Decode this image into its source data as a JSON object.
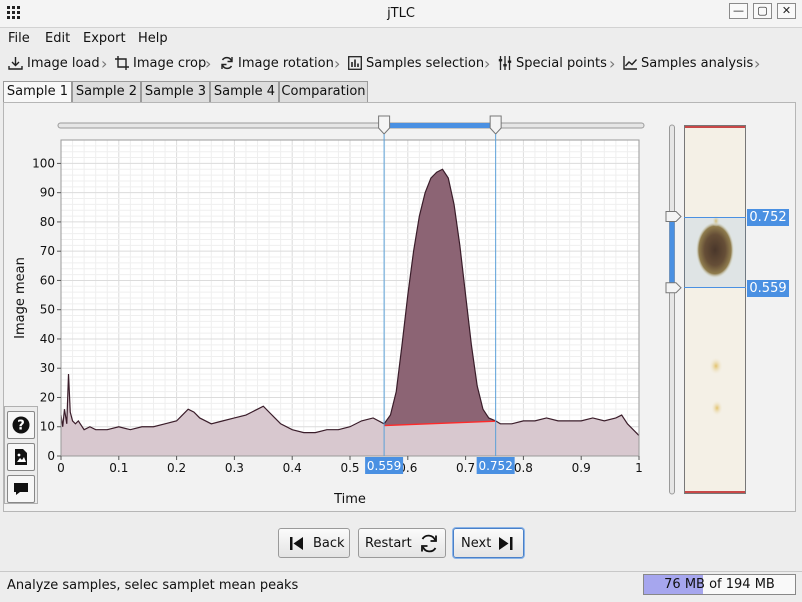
{
  "window": {
    "title": "jTLC",
    "min_symbol": "—",
    "max_symbol": "▢",
    "close_symbol": "✕"
  },
  "menu": {
    "items": [
      "File",
      "Edit",
      "Export",
      "Help"
    ]
  },
  "breadcrumb": {
    "items": [
      {
        "label": "Image load",
        "icon": "download-icon"
      },
      {
        "label": "Image crop",
        "icon": "crop-icon"
      },
      {
        "label": "Image rotation",
        "icon": "rotate-icon"
      },
      {
        "label": "Samples selection",
        "icon": "bar-chart-icon"
      },
      {
        "label": "Special points",
        "icon": "sliders-icon"
      },
      {
        "label": "Samples analysis",
        "icon": "line-chart-icon"
      }
    ]
  },
  "tabs": {
    "items": [
      "Sample 1",
      "Sample 2",
      "Sample 3",
      "Sample 4",
      "Comparation"
    ],
    "selected": 0
  },
  "range_slider": {
    "low": 0.559,
    "high": 0.752,
    "low_label": "0.559",
    "high_label": "0.752"
  },
  "strip": {
    "high_label": "0.752",
    "low_label": "0.559"
  },
  "chart_data": {
    "type": "area",
    "xlabel": "Time",
    "ylabel": "Image mean",
    "xlim": [
      0,
      1
    ],
    "ylim": [
      0,
      108
    ],
    "x_ticks": [
      0,
      0.1,
      0.2,
      0.3,
      0.4,
      0.5,
      0.6,
      0.7,
      0.8,
      0.9,
      1
    ],
    "x_tick_labels": [
      "0",
      "0.1",
      "0.2",
      "0.3",
      "0.4",
      "0.5",
      "0.6",
      "0.7",
      "0.8",
      "0.9",
      "1"
    ],
    "y_ticks": [
      0,
      10,
      20,
      30,
      40,
      50,
      60,
      70,
      80,
      90,
      100
    ],
    "y_tick_labels": [
      "0",
      "10",
      "20",
      "30",
      "40",
      "50",
      "60",
      "70",
      "80",
      "90",
      "100"
    ],
    "grid": true,
    "colors": {
      "area": "#d8c8cf",
      "peak_area": "#8c6474",
      "line": "#3a1d2a",
      "baseline": "#ff2a2a",
      "selection": "#5aa0d8"
    },
    "series": [
      {
        "x": [
          0,
          0.003,
          0.006,
          0.01,
          0.013,
          0.016,
          0.02,
          0.025,
          0.03,
          0.04,
          0.05,
          0.06,
          0.08,
          0.1,
          0.12,
          0.14,
          0.16,
          0.18,
          0.2,
          0.21,
          0.22,
          0.23,
          0.24,
          0.26,
          0.28,
          0.3,
          0.32,
          0.33,
          0.34,
          0.35,
          0.36,
          0.37,
          0.38,
          0.4,
          0.42,
          0.44,
          0.46,
          0.48,
          0.5,
          0.52,
          0.54,
          0.559,
          0.57,
          0.58,
          0.59,
          0.6,
          0.61,
          0.62,
          0.63,
          0.64,
          0.65,
          0.66,
          0.67,
          0.68,
          0.69,
          0.7,
          0.71,
          0.72,
          0.73,
          0.74,
          0.752,
          0.76,
          0.78,
          0.8,
          0.82,
          0.84,
          0.86,
          0.88,
          0.9,
          0.92,
          0.94,
          0.96,
          0.97,
          0.98,
          0.99,
          1
        ],
        "y": [
          14,
          10,
          16,
          11,
          28,
          15,
          12,
          11,
          12,
          9,
          10,
          9,
          9,
          10,
          9,
          10,
          10,
          11,
          12,
          14,
          16,
          15,
          13,
          11,
          12,
          13,
          14,
          15,
          16,
          17,
          15,
          13,
          11,
          9,
          8,
          8,
          9,
          9,
          10,
          12,
          13,
          11,
          14,
          22,
          38,
          55,
          70,
          82,
          90,
          95,
          97,
          98,
          95,
          86,
          72,
          55,
          38,
          24,
          16,
          13,
          12,
          11,
          11,
          12,
          12,
          13,
          12,
          12,
          12,
          13,
          12,
          13,
          14,
          11,
          9,
          7
        ]
      }
    ],
    "baseline": {
      "x": [
        0.559,
        0.752
      ],
      "y": [
        10.4,
        11.9
      ]
    }
  },
  "nav": {
    "back": "Back",
    "restart": "Restart",
    "next": "Next"
  },
  "status": {
    "message": "Analyze samples, selec samplet mean peaks",
    "memory_used": "76 MB",
    "memory_total": "of 194 MB",
    "memory_fraction": 0.39
  }
}
